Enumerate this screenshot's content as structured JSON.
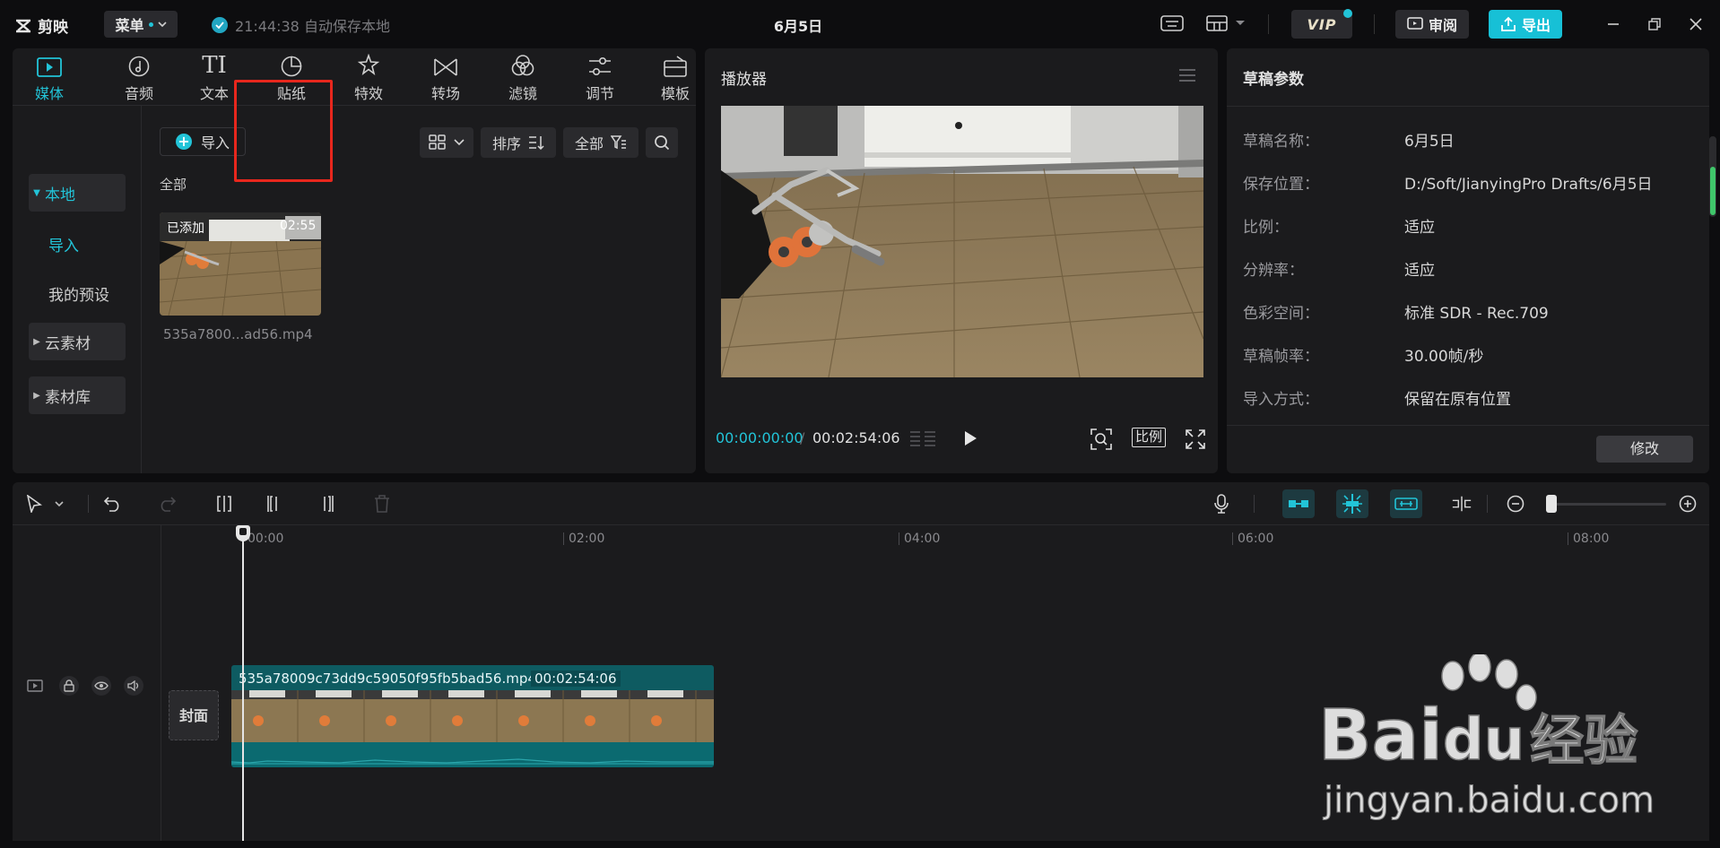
{
  "app": {
    "logo_text": "剪映",
    "menu_label": "菜单",
    "autosave_text": "21:44:38 自动保存本地",
    "project_title": "6月5日",
    "vip_label": "VIP",
    "review_label": "审阅",
    "export_label": "导出"
  },
  "media": {
    "tabs": [
      {
        "label": "媒体",
        "icon": "media-icon",
        "active": true
      },
      {
        "label": "音频",
        "icon": "audio-icon"
      },
      {
        "label": "文本",
        "icon": "text-icon"
      },
      {
        "label": "贴纸",
        "icon": "sticker-icon"
      },
      {
        "label": "特效",
        "icon": "effects-icon"
      },
      {
        "label": "转场",
        "icon": "transition-icon"
      },
      {
        "label": "滤镜",
        "icon": "filter-icon"
      },
      {
        "label": "调节",
        "icon": "adjust-icon"
      },
      {
        "label": "模板",
        "icon": "template-icon"
      }
    ],
    "nav": {
      "local": "本地",
      "import": "导入",
      "my_presets": "我的预设",
      "cloud": "云素材",
      "library": "素材库"
    },
    "import_label": "导入",
    "sort_label": "排序",
    "filter_label": "全部",
    "section_label": "全部",
    "item": {
      "added_badge": "已添加",
      "duration": "02:55",
      "filename": "535a7800...ad56.mp4"
    }
  },
  "player": {
    "title": "播放器",
    "time_current": "00:00:00:00",
    "time_sep": "/",
    "time_total": "00:02:54:06",
    "ratio_label": "比例"
  },
  "props": {
    "title": "草稿参数",
    "rows": [
      {
        "key": "草稿名称：",
        "value": "6月5日"
      },
      {
        "key": "保存位置：",
        "value": "D:/Soft/JianyingPro Drafts/6月5日"
      },
      {
        "key": "比例：",
        "value": "适应"
      },
      {
        "key": "分辨率：",
        "value": "适应"
      },
      {
        "key": "色彩空间：",
        "value": "标准 SDR - Rec.709"
      },
      {
        "key": "草稿帧率：",
        "value": "30.00帧/秒"
      },
      {
        "key": "导入方式：",
        "value": "保留在原有位置"
      }
    ],
    "modify_label": "修改"
  },
  "timeline": {
    "ruler": [
      "00:00",
      "02:00",
      "04:00",
      "06:00",
      "08:00"
    ],
    "cover_label": "封面",
    "clip_name": "535a78009c73dd9c59050f95fb5bad56.mp4",
    "clip_duration": "00:02:54:06"
  },
  "watermark": {
    "brand": "Bai",
    "brand2": "du",
    "brand_cn": "经验",
    "url": "jingyan.baidu.com"
  },
  "colors": {
    "accent": "#22c4d8",
    "highlight_box": "#e8271d",
    "clip": "#0e5b61"
  }
}
